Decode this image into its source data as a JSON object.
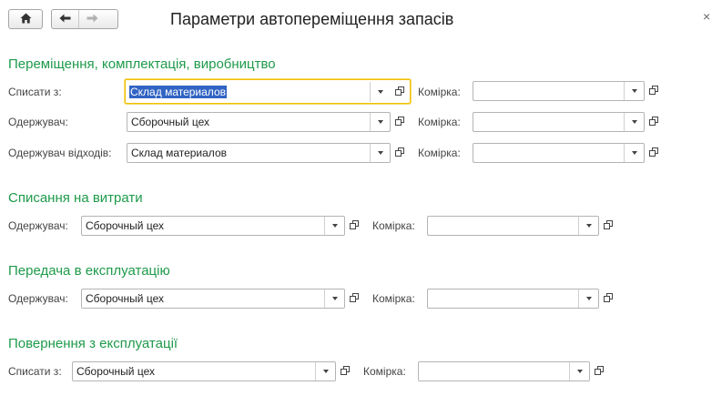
{
  "window": {
    "title": "Параметри автопереміщення запасів",
    "close_glyph": "×"
  },
  "toolbar": {
    "home_icon": "home-icon",
    "back_icon": "arrow-left-icon",
    "forward_icon": "arrow-right-icon"
  },
  "sections": {
    "movement": {
      "title": "Переміщення, комплектація, виробництво",
      "rows": [
        {
          "label": "Списати з:",
          "value": "Склад материалов",
          "cell_label": "Комірка:",
          "cell_value": ""
        },
        {
          "label": "Одержувач:",
          "value": "Сборочный цех",
          "cell_label": "Комірка:",
          "cell_value": ""
        },
        {
          "label": "Одержувач відходів:",
          "value": "Склад материалов",
          "cell_label": "Комірка:",
          "cell_value": ""
        }
      ]
    },
    "writeoff": {
      "title": "Списання на витрати",
      "row": {
        "label": "Одержувач:",
        "value": "Сборочный цех",
        "cell_label": "Комірка:",
        "cell_value": ""
      }
    },
    "transfer": {
      "title": "Передача в експлуатацію",
      "row": {
        "label": "Одержувач:",
        "value": "Сборочный цех",
        "cell_label": "Комірка:",
        "cell_value": ""
      }
    },
    "return": {
      "title": "Повернення з експлуатації",
      "row": {
        "label": "Списати з:",
        "value": "Сборочный цех",
        "cell_label": "Комірка:",
        "cell_value": ""
      }
    }
  },
  "colors": {
    "section_title": "#1e9a4a",
    "focus_border": "#f0c000",
    "selection": "#3164c4"
  }
}
